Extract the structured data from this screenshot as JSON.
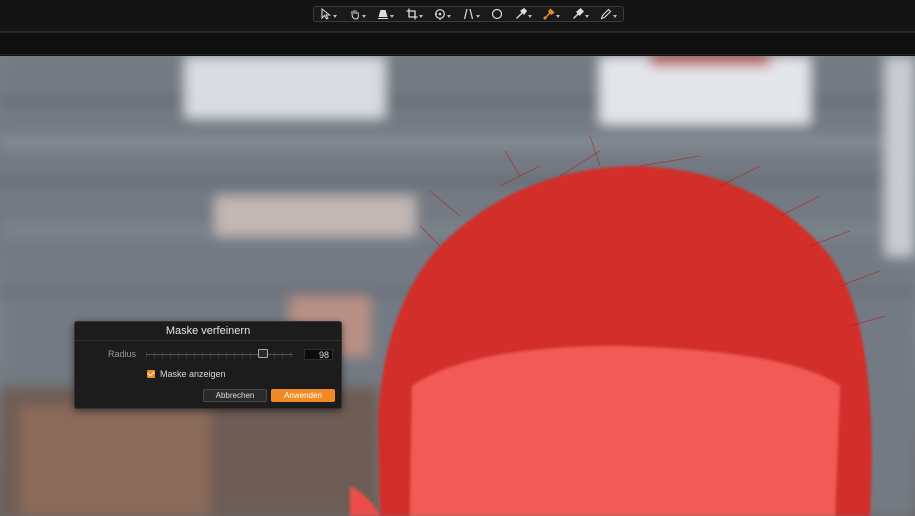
{
  "toolbar": {
    "tools": [
      {
        "icon": "pointer-arrow-icon"
      },
      {
        "icon": "hand-pan-icon"
      },
      {
        "icon": "keystone-icon"
      },
      {
        "icon": "crop-icon"
      },
      {
        "icon": "rotate-icon"
      },
      {
        "icon": "perspective-icon"
      },
      {
        "icon": "circle-icon"
      },
      {
        "icon": "eyedropper-icon"
      },
      {
        "icon": "brush-active-icon"
      },
      {
        "icon": "eraser-icon"
      },
      {
        "icon": "pencil-icon"
      }
    ],
    "active_color": "#f08a24"
  },
  "photo": {
    "mask_color": "#e03030"
  },
  "dialog": {
    "title": "Maske verfeinern",
    "radius_label": "Radius",
    "radius_value": "98",
    "show_mask_label": "Maske anzeigen",
    "show_mask_checked": true,
    "cancel_label": "Abbrechen",
    "apply_label": "Anwenden"
  }
}
